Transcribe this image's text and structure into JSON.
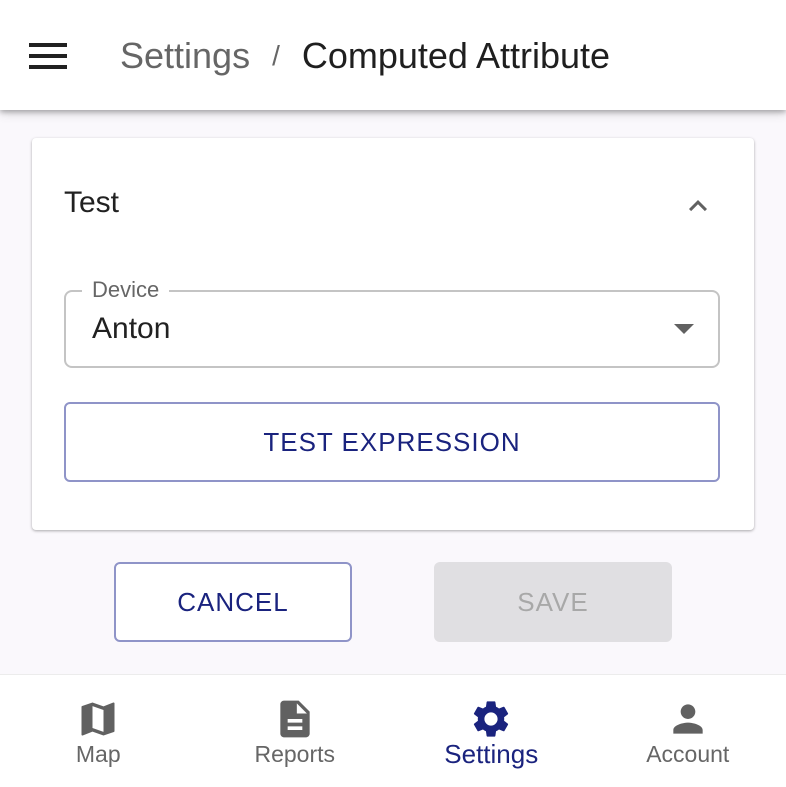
{
  "header": {
    "breadcrumb_parent": "Settings",
    "breadcrumb_separator": "/",
    "breadcrumb_current": "Computed Attribute"
  },
  "test_panel": {
    "title": "Test",
    "device_field": {
      "label": "Device",
      "value": "Anton"
    },
    "test_button_label": "TEST EXPRESSION"
  },
  "actions": {
    "cancel_label": "CANCEL",
    "save_label": "SAVE"
  },
  "bottom_nav": {
    "items": [
      {
        "label": "Map",
        "icon": "map-icon"
      },
      {
        "label": "Reports",
        "icon": "document-icon"
      },
      {
        "label": "Settings",
        "icon": "gear-icon",
        "active": true
      },
      {
        "label": "Account",
        "icon": "person-icon"
      }
    ]
  },
  "colors": {
    "accent": "#1a237e",
    "disabled_bg": "#e0dfe2",
    "outline": "#8f94c8",
    "page_bg": "#faf8fc"
  }
}
